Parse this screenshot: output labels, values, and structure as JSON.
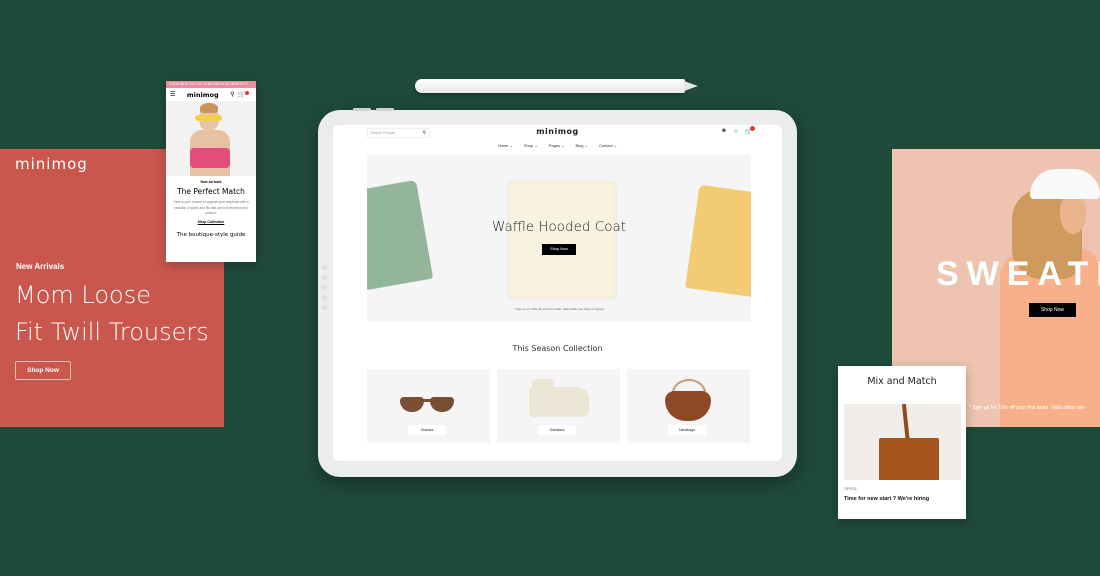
{
  "brand": "minimog",
  "left_banner": {
    "logo": "minimog",
    "eyebrow": "New Arrivals",
    "headline_line1": "Mom Loose",
    "headline_line2": "Fit Twill Trousers",
    "button": "Shop Now",
    "bg_color": "#c9574e"
  },
  "mobile_preview": {
    "promo_bar": "CODA NEW COLOR: STERLING ♥ SO WORTH IT",
    "logo": "minimog",
    "cart_count": "0",
    "eyebrow": "New Arrivals",
    "title": "The Perfect Match",
    "description": "Here is your chance to upgrade your wardrobe with a variation of styles and fits that are both feminine and relaxed.",
    "link": "Shop Collection",
    "footer": "The boutique-style guide"
  },
  "tablet": {
    "search_placeholder": "Search Product",
    "logo": "minimog",
    "cart_count": "0",
    "menu": [
      "Home",
      "Shop",
      "Pages",
      "Blog",
      "Contact"
    ],
    "hero": {
      "title": "Waffle Hooded Coat",
      "button": "Shop Now",
      "note": "* Sign up for 10% off your first order. Valid within two days of signup."
    },
    "section_title": "This Season Collection",
    "categories": [
      {
        "label": "Glasses"
      },
      {
        "label": "Sneakers"
      },
      {
        "label": "Handbags"
      }
    ]
  },
  "right_banner": {
    "headline": "SWEATE",
    "button": "Shop Now",
    "note": "* Sign up for 10% off your first order. Valid within two",
    "bg_color": "#eec4b0"
  },
  "mix_card": {
    "title": "Mix and Match",
    "tag": "OFFICE",
    "post_title": "Time for new start ? We're hiring"
  },
  "colors": {
    "background": "#1f4a3a",
    "badge": "#e23b3b",
    "promo": "#e98d9c"
  }
}
